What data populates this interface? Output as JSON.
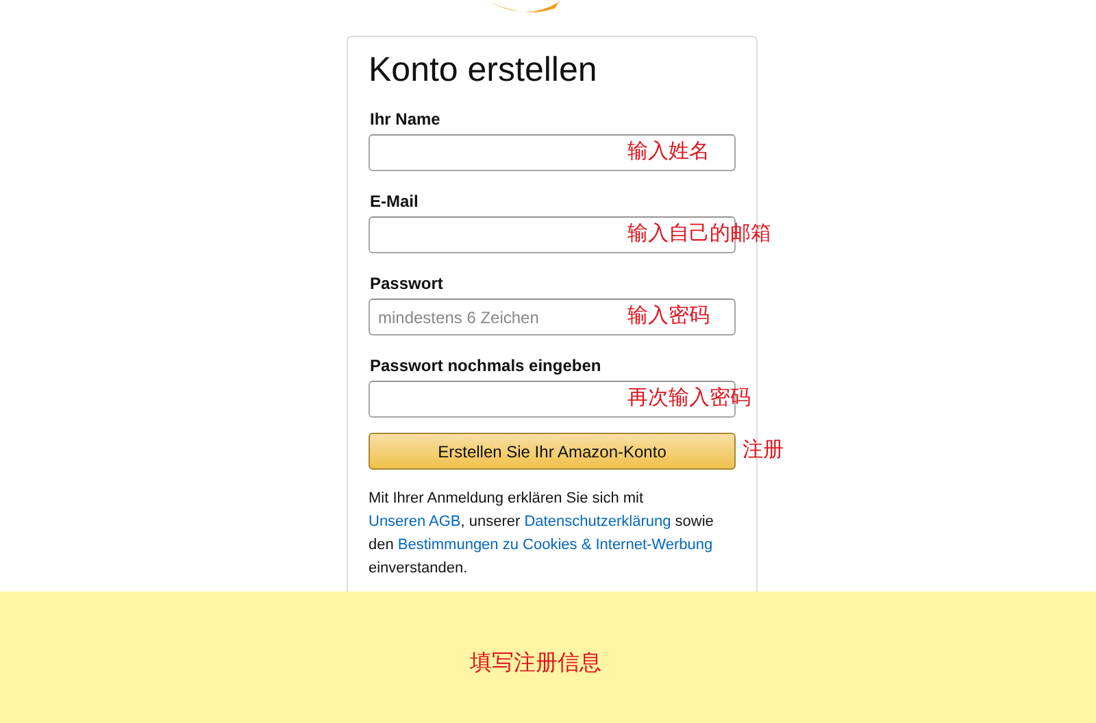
{
  "form": {
    "title": "Konto erstellen",
    "fields": [
      {
        "label": "Ihr Name",
        "annotation": "输入姓名"
      },
      {
        "label": "E-Mail",
        "annotation": "输入自己的邮箱"
      },
      {
        "label": "Passwort",
        "placeholder": "mindestens 6 Zeichen",
        "annotation": "输入密码"
      },
      {
        "label": "Passwort nochmals eingeben",
        "annotation": "再次输入密码"
      }
    ],
    "submit": {
      "label": "Erstellen Sie Ihr Amazon-Konto",
      "annotation": "注册"
    },
    "legal": [
      {
        "kind": "text",
        "text": "Mit Ihrer Anmeldung erklären Sie sich mit "
      },
      {
        "kind": "link",
        "text": "Unseren AGB"
      },
      {
        "kind": "text",
        "text": ", unserer "
      },
      {
        "kind": "link",
        "text": "Datenschutzerklärung"
      },
      {
        "kind": "text",
        "text": " sowie den "
      },
      {
        "kind": "link",
        "text": "Bestimmungen zu Cookies & Internet-Werbung"
      },
      {
        "kind": "text",
        "text": " einverstanden."
      }
    ]
  },
  "banner": {
    "text": "填写注册信息"
  }
}
